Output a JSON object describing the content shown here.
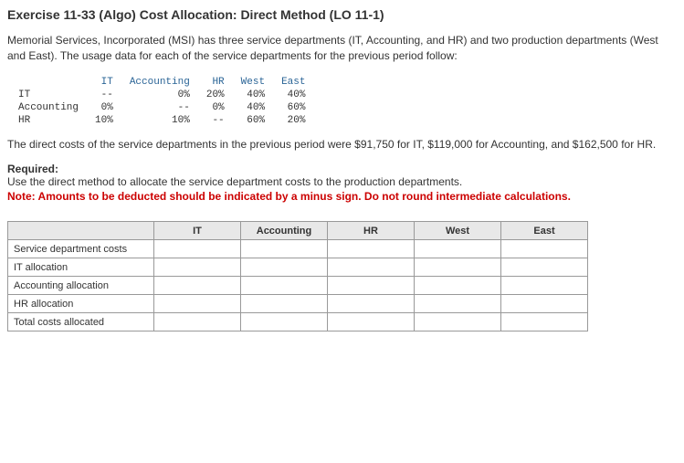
{
  "title": "Exercise 11-33 (Algo) Cost Allocation: Direct Method (LO 11-1)",
  "intro": "Memorial Services, Incorporated (MSI) has three service departments (IT, Accounting, and HR) and two production departments (West and East). The usage data for each of the service departments for the previous period follow:",
  "usage": {
    "headers": [
      "",
      "IT",
      "Accounting",
      "HR",
      "West",
      "East"
    ],
    "rows": [
      {
        "label": "IT",
        "cells": [
          "--",
          "0%",
          "20%",
          "40%",
          "40%"
        ]
      },
      {
        "label": "Accounting",
        "cells": [
          "0%",
          "--",
          "0%",
          "40%",
          "60%"
        ]
      },
      {
        "label": "HR",
        "cells": [
          "10%",
          "10%",
          "--",
          "60%",
          "20%"
        ]
      }
    ]
  },
  "direct_costs_text": "The direct costs of the service departments in the previous period were $91,750 for IT, $119,000 for Accounting, and $162,500 for HR.",
  "required_label": "Required:",
  "required_text": "Use the direct method to allocate the service department costs to the production departments.",
  "note_text": "Note: Amounts to be deducted should be indicated by a minus sign. Do not round intermediate calculations.",
  "answer": {
    "columns": [
      "IT",
      "Accounting",
      "HR",
      "West",
      "East"
    ],
    "rows": [
      "Service department costs",
      "IT allocation",
      "Accounting allocation",
      "HR allocation",
      "Total costs allocated"
    ]
  },
  "chart_data": {
    "type": "table",
    "title": "Service Department Usage Percentages",
    "categories": [
      "IT",
      "Accounting",
      "HR",
      "West",
      "East"
    ],
    "series": [
      {
        "name": "IT",
        "values": [
          null,
          0,
          20,
          40,
          40
        ]
      },
      {
        "name": "Accounting",
        "values": [
          0,
          null,
          0,
          40,
          60
        ]
      },
      {
        "name": "HR",
        "values": [
          10,
          10,
          null,
          60,
          20
        ]
      }
    ],
    "direct_costs": {
      "IT": 91750,
      "Accounting": 119000,
      "HR": 162500
    }
  }
}
